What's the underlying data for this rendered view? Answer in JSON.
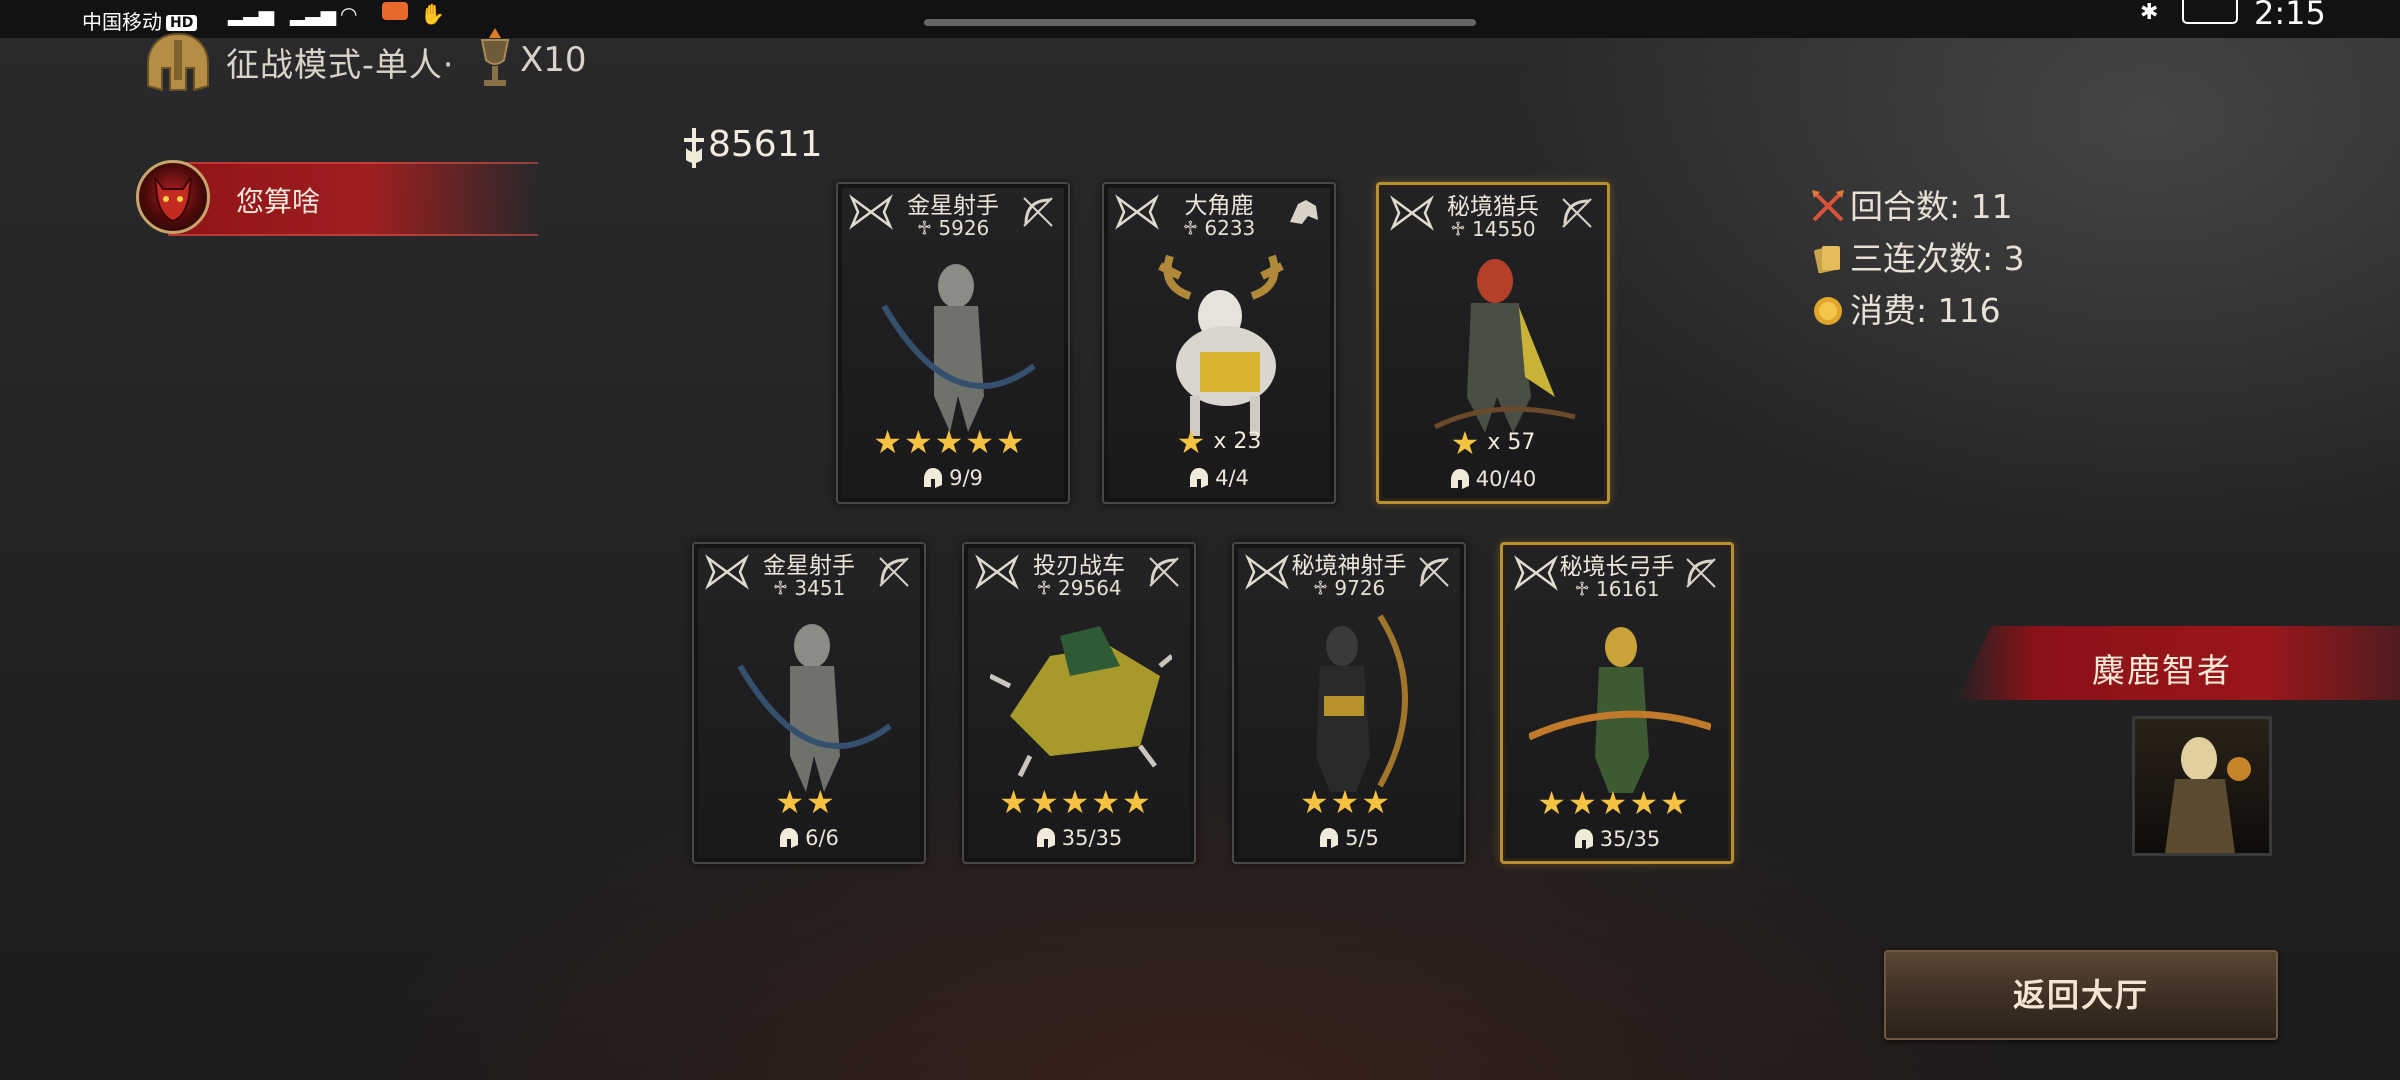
{
  "status_bar": {
    "carrier": "中国移动",
    "hd_badge": "HD",
    "clock": "2:15"
  },
  "header": {
    "mode_title": "征战模式-单人·",
    "multiplier": "X10"
  },
  "player": {
    "name": "您算啥"
  },
  "team": {
    "total_power": "85611"
  },
  "cards_row1": [
    {
      "name": "金星射手",
      "power": "5926",
      "stars": "★★★★★",
      "star_mult": "",
      "count": "9/9",
      "gold": false
    },
    {
      "name": "大角鹿",
      "power": "6233",
      "stars": "★",
      "star_mult": "x 23",
      "count": "4/4",
      "gold": false
    },
    {
      "name": "秘境猎兵",
      "power": "14550",
      "stars": "★",
      "star_mult": "x 57",
      "count": "40/40",
      "gold": true
    }
  ],
  "cards_row2": [
    {
      "name": "金星射手",
      "power": "3451",
      "stars": "★★",
      "star_mult": "",
      "count": "6/6",
      "gold": false
    },
    {
      "name": "投刃战车",
      "power": "29564",
      "stars": "★★★★★",
      "star_mult": "",
      "count": "35/35",
      "gold": false
    },
    {
      "name": "秘境神射手",
      "power": "9726",
      "stars": "★★★",
      "star_mult": "",
      "count": "5/5",
      "gold": false
    },
    {
      "name": "秘境长弓手",
      "power": "16161",
      "stars": "★★★★★",
      "star_mult": "",
      "count": "35/35",
      "gold": true
    }
  ],
  "stats": {
    "rounds": "回合数: 11",
    "triples": "三连次数: 3",
    "cost": "消费: 116"
  },
  "hero": {
    "name": "麋鹿智者"
  },
  "buttons": {
    "return_lobby": "返回大厅"
  },
  "colors": {
    "star": "#f5c341",
    "gold_border": "#b8902e",
    "banner_red": "#9a161b"
  }
}
